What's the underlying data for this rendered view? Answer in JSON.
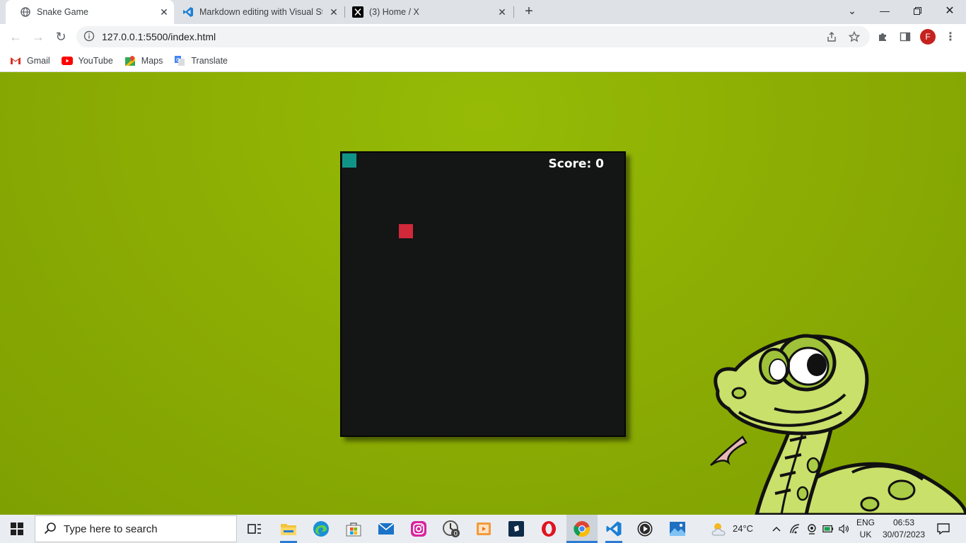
{
  "browser": {
    "tabs": [
      {
        "title": "Snake Game",
        "icon": "globe-icon",
        "active": true
      },
      {
        "title": "Markdown editing with Visual Stu",
        "icon": "vscode-icon",
        "active": false
      },
      {
        "title": "(3) Home / X",
        "icon": "x-logo-icon",
        "active": false
      }
    ],
    "new_tab_label": "+",
    "address": "127.0.0.1:5500/index.html",
    "profile_initial": "F",
    "bookmarks": [
      {
        "label": "Gmail",
        "icon": "gmail-icon"
      },
      {
        "label": "YouTube",
        "icon": "youtube-icon"
      },
      {
        "label": "Maps",
        "icon": "maps-icon"
      },
      {
        "label": "Translate",
        "icon": "translate-icon"
      }
    ]
  },
  "game": {
    "score_text": "Score: 0",
    "board_color": "#141515",
    "snake_color": "#119488",
    "food_color": "#d1283a",
    "background_color": "#8aac04"
  },
  "taskbar": {
    "search_placeholder": "Type here to search",
    "weather": "24°C",
    "language_line1": "ENG",
    "language_line2": "UK",
    "time": "06:53",
    "date": "30/07/2023"
  }
}
